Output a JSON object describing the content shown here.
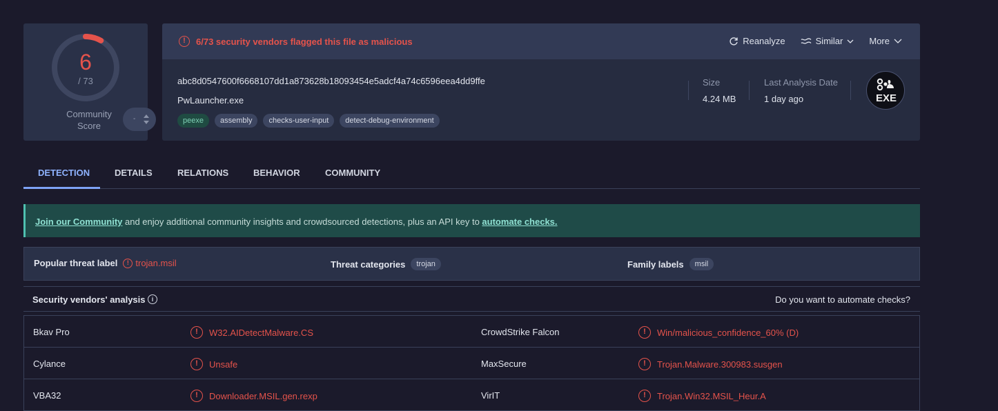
{
  "score": {
    "detections": "6",
    "total": "/ 73",
    "detection_ratio": 0.0822,
    "community_label": "Community Score",
    "stepper_value": "-"
  },
  "alert": {
    "icon": "alert-circle-icon",
    "text": "6/73 security vendors flagged this file as malicious"
  },
  "actions": {
    "reanalyze": "Reanalyze",
    "similar": "Similar",
    "more": "More"
  },
  "file": {
    "hash": "abc8d0547600f6668107dd1a873628b18093454e5adcf4a74c6596eea4dd9ffe",
    "name": "PwLauncher.exe",
    "tags": [
      "peexe",
      "assembly",
      "checks-user-input",
      "detect-debug-environment"
    ],
    "size_label": "Size",
    "size_value": "4.24 MB",
    "date_label": "Last Analysis Date",
    "date_value": "1 day ago",
    "type_badge": "EXE"
  },
  "tabs": [
    "DETECTION",
    "DETAILS",
    "RELATIONS",
    "BEHAVIOR",
    "COMMUNITY"
  ],
  "banner": {
    "link1": "Join our Community",
    "middle": " and enjoy additional community insights and crowdsourced detections, plus an API key to ",
    "link2": "automate checks."
  },
  "labels": {
    "popular_key": "Popular threat label",
    "popular_value": "trojan.msil",
    "categories_key": "Threat categories",
    "categories_value": "trojan",
    "family_key": "Family labels",
    "family_value": "msil"
  },
  "vendors_header": {
    "title": "Security vendors' analysis",
    "info_icon": "info-icon",
    "automate": "Do you want to automate checks?"
  },
  "vendors": [
    {
      "left_name": "Bkav Pro",
      "left_result": "W32.AIDetectMalware.CS",
      "right_name": "CrowdStrike Falcon",
      "right_result": "Win/malicious_confidence_60% (D)"
    },
    {
      "left_name": "Cylance",
      "left_result": "Unsafe",
      "right_name": "MaxSecure",
      "right_result": "Trojan.Malware.300983.susgen"
    },
    {
      "left_name": "VBA32",
      "left_result": "Downloader.MSIL.gen.rexp",
      "right_name": "VirIT",
      "right_result": "Trojan.Win32.MSIL_Heur.A"
    }
  ],
  "colors": {
    "malicious": "#e5534b",
    "accent": "#7ea3f7",
    "banner": "#1f4b48"
  }
}
